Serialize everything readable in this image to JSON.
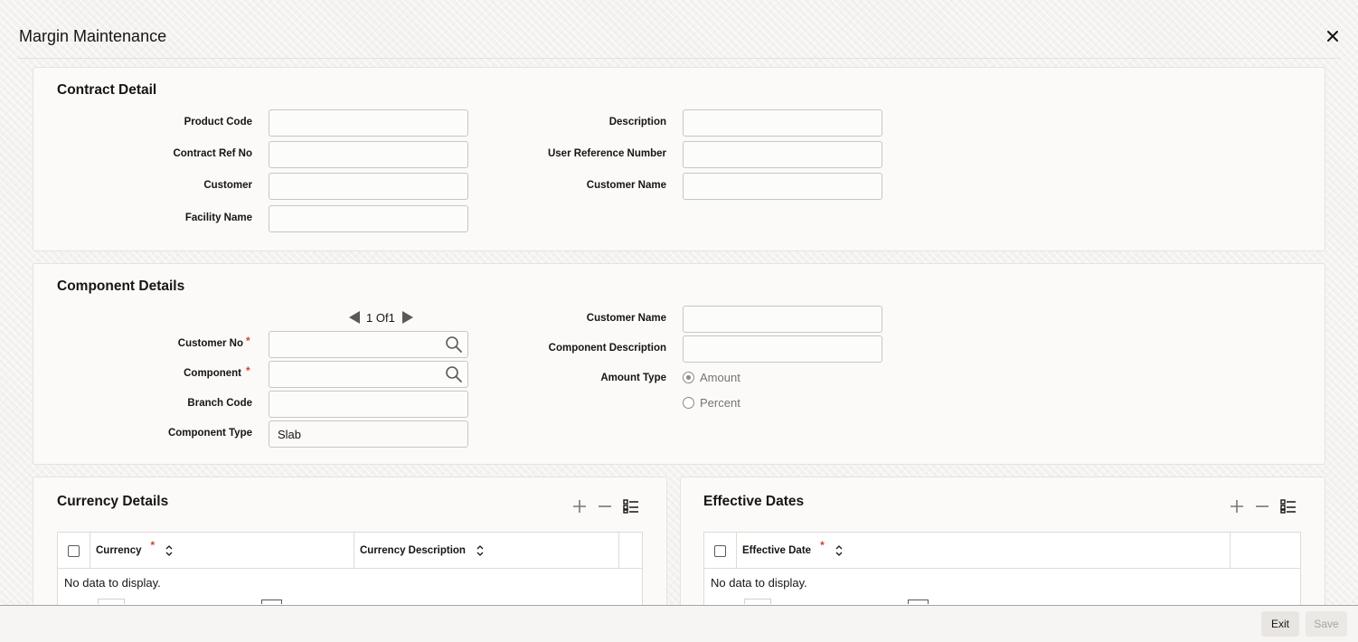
{
  "window": {
    "title": "Margin Maintenance",
    "close_icon": "close-icon"
  },
  "contract_detail": {
    "title": "Contract Detail",
    "product_code": {
      "label": "Product Code",
      "value": ""
    },
    "contract_ref_no": {
      "label": "Contract Ref No",
      "value": ""
    },
    "customer": {
      "label": "Customer",
      "value": ""
    },
    "facility_name": {
      "label": "Facility Name",
      "value": ""
    },
    "description": {
      "label": "Description",
      "value": ""
    },
    "user_reference_number": {
      "label": "User Reference Number",
      "value": ""
    },
    "customer_name": {
      "label": "Customer Name",
      "value": ""
    }
  },
  "component_details": {
    "title": "Component Details",
    "pager": {
      "current": "1",
      "of_label": "Of",
      "total": "1"
    },
    "customer_no": {
      "label": "Customer No",
      "required": "*",
      "value": ""
    },
    "component": {
      "label": "Component",
      "required": "*",
      "value": ""
    },
    "branch_code": {
      "label": "Branch Code",
      "value": ""
    },
    "component_type": {
      "label": "Component Type",
      "value": "Slab"
    },
    "customer_name": {
      "label": "Customer Name",
      "value": ""
    },
    "component_description": {
      "label": "Component Description",
      "value": ""
    },
    "amount_type": {
      "label": "Amount Type",
      "options": [
        "Amount",
        "Percent"
      ],
      "selected": "Amount"
    }
  },
  "currency_details": {
    "title": "Currency Details",
    "columns": [
      {
        "label": "Currency",
        "required": "*"
      },
      {
        "label": "Currency Description"
      }
    ],
    "empty_text": "No data to display."
  },
  "effective_dates": {
    "title": "Effective Dates",
    "columns": [
      {
        "label": "Effective Date",
        "required": "*"
      }
    ],
    "empty_text": "No data to display."
  },
  "footer": {
    "exit_label": "Exit",
    "save_label": "Save"
  },
  "colors": {
    "required": "#c74634",
    "accent_text": "#161513",
    "disabled_text": "#a9a5a0"
  }
}
